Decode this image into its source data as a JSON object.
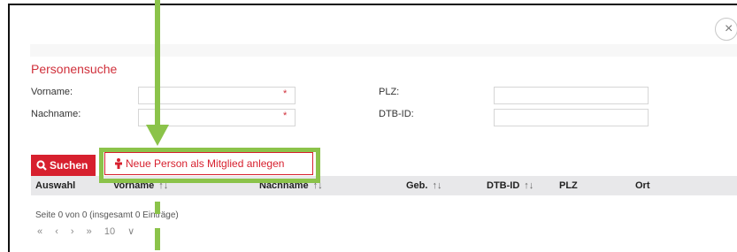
{
  "dialog": {
    "close_glyph": "×",
    "title": "Personensuche"
  },
  "form": {
    "vorname_label": "Vorname:",
    "nachname_label": "Nachname:",
    "plz_label": "PLZ:",
    "dtbid_label": "DTB-ID:",
    "required_mark": "*"
  },
  "buttons": {
    "search_label": "Suchen",
    "new_person_label": "Neue Person als Mitglied anlegen"
  },
  "table": {
    "columns": [
      "Auswahl",
      "Vorname",
      "Nachname",
      "Geb.",
      "DTB-ID",
      "PLZ",
      "Ort"
    ],
    "sort_glyph": "↑↓"
  },
  "pagination": {
    "info": "Seite 0 von 0 (insgesamt 0 Einträge)",
    "first": "«",
    "prev": "‹",
    "next": "›",
    "last": "»",
    "page_size": "10",
    "dropdown_glyph": "∨"
  },
  "annotation": {
    "highlight_color": "#8bc34a"
  },
  "colors": {
    "accent": "#d7202e"
  }
}
